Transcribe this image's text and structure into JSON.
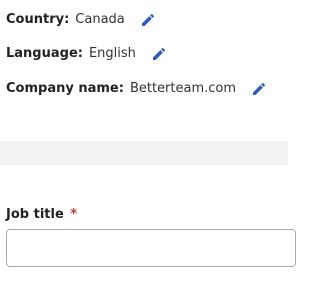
{
  "details": {
    "country": {
      "label": "Country:",
      "value": "Canada"
    },
    "language": {
      "label": "Language:",
      "value": "English"
    },
    "company": {
      "label": "Company name:",
      "value": "Betterteam.com"
    }
  },
  "job_title": {
    "label": "Job title",
    "required_marker": "*",
    "value": "",
    "placeholder": ""
  },
  "icons": {
    "edit": "pencil-icon"
  },
  "colors": {
    "accent": "#2d5bb7",
    "required": "#d0312d",
    "band": "#f3f3f3",
    "input_border": "#a9a9a9"
  }
}
